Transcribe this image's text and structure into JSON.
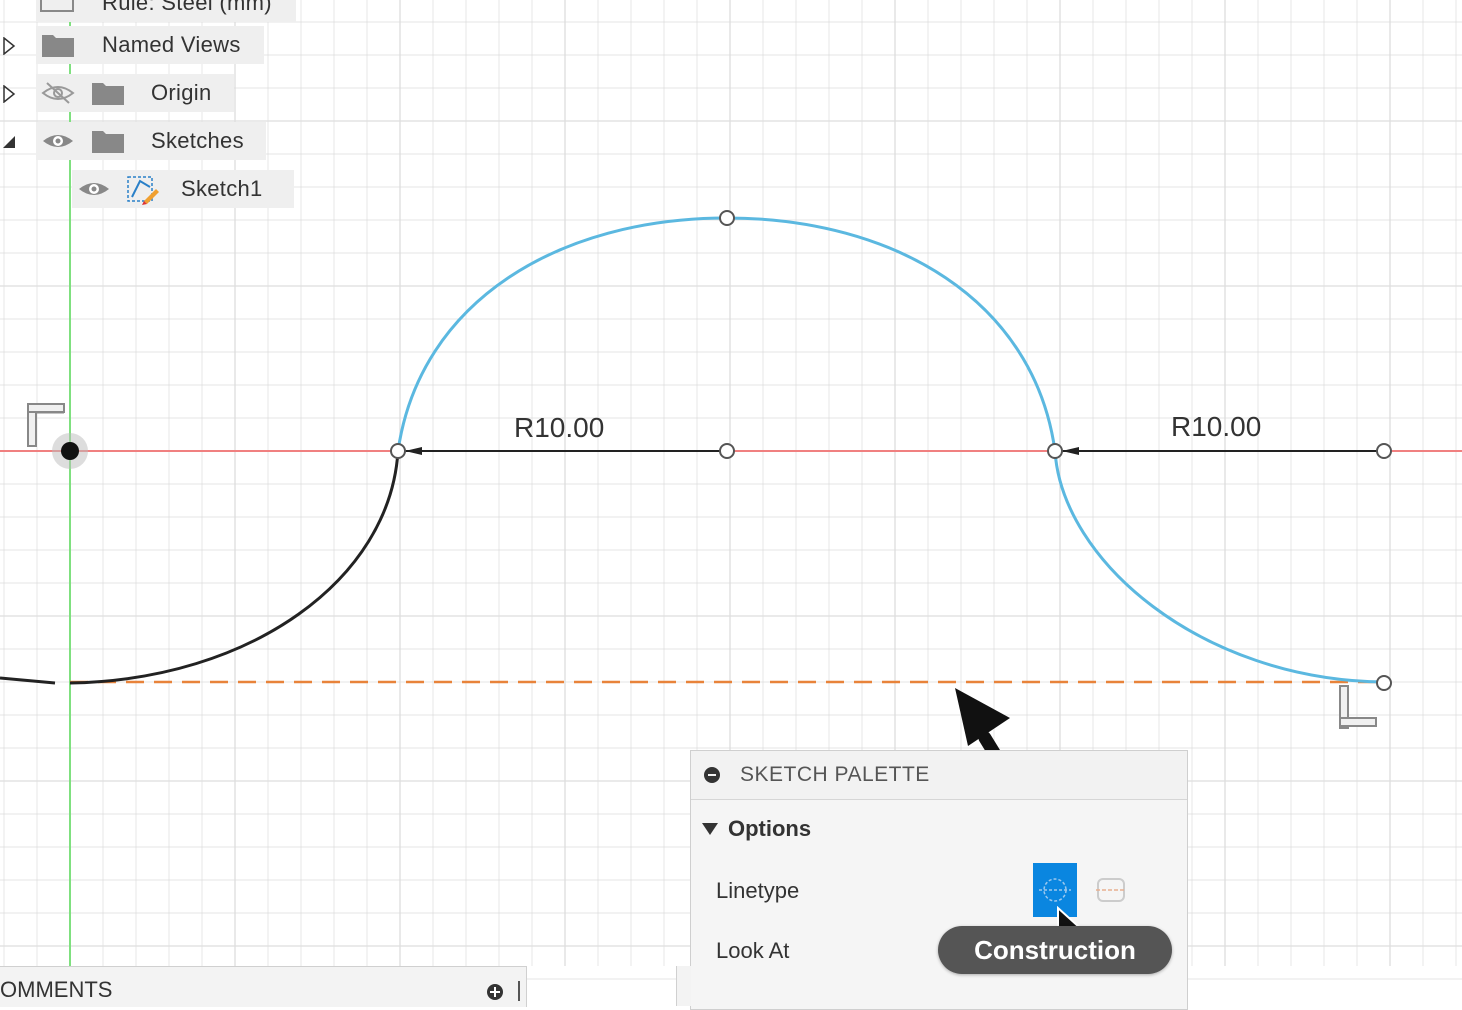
{
  "browser": {
    "items": [
      {
        "label": "Rule: Steel (mm)"
      },
      {
        "label": "Named Views"
      },
      {
        "label": "Origin"
      },
      {
        "label": "Sketches"
      },
      {
        "label": "Sketch1"
      }
    ]
  },
  "canvas": {
    "dimensions": [
      "R10.00",
      "R10.00"
    ],
    "colors": {
      "grid": "#dddddd",
      "axis_x": "#f08080",
      "axis_y": "#7fe07f",
      "sketch_selected": "#5bb8e0",
      "sketch_line": "#222222",
      "construction": "#e8833a"
    }
  },
  "palette": {
    "title": "SKETCH PALETTE",
    "section": "Options",
    "rows": [
      {
        "label": "Linetype"
      },
      {
        "label": "Look At"
      }
    ]
  },
  "tooltip": {
    "text": "Construction"
  },
  "comments": {
    "label": "OMMENTS"
  }
}
